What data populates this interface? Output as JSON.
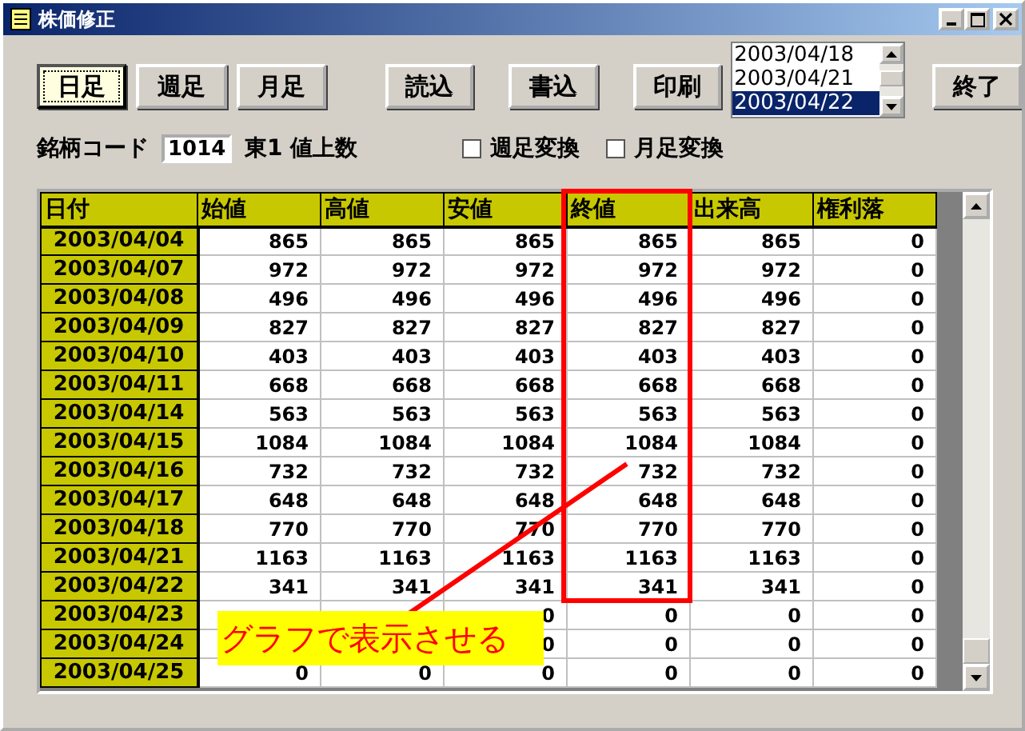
{
  "window": {
    "title": "株価修正"
  },
  "period_buttons": [
    {
      "label": "日足",
      "selected": true
    },
    {
      "label": "週足",
      "selected": false
    },
    {
      "label": "月足",
      "selected": false
    }
  ],
  "action_buttons": [
    "読込",
    "書込",
    "印刷"
  ],
  "date_list": [
    {
      "label": "2003/04/18",
      "selected": false
    },
    {
      "label": "2003/04/21",
      "selected": false
    },
    {
      "label": "2003/04/22",
      "selected": true
    }
  ],
  "exit_button": "終了",
  "code": {
    "label": "銘柄コード",
    "value": "1014",
    "name": "東1 値上数"
  },
  "options": [
    {
      "label": "週足変換",
      "checked": false
    },
    {
      "label": "月足変換",
      "checked": false
    }
  ],
  "table": {
    "columns": [
      {
        "label": "日付",
        "highlighted": false
      },
      {
        "label": "始値",
        "highlighted": false
      },
      {
        "label": "高値",
        "highlighted": false
      },
      {
        "label": "安値",
        "highlighted": false
      },
      {
        "label": "終値",
        "highlighted": true
      },
      {
        "label": "出来高",
        "highlighted": false
      },
      {
        "label": "権利落",
        "highlighted": false
      }
    ],
    "rows": [
      [
        "2003/04/04",
        "865",
        "865",
        "865",
        "865",
        "865",
        "0"
      ],
      [
        "2003/04/07",
        "972",
        "972",
        "972",
        "972",
        "972",
        "0"
      ],
      [
        "2003/04/08",
        "496",
        "496",
        "496",
        "496",
        "496",
        "0"
      ],
      [
        "2003/04/09",
        "827",
        "827",
        "827",
        "827",
        "827",
        "0"
      ],
      [
        "2003/04/10",
        "403",
        "403",
        "403",
        "403",
        "403",
        "0"
      ],
      [
        "2003/04/11",
        "668",
        "668",
        "668",
        "668",
        "668",
        "0"
      ],
      [
        "2003/04/14",
        "563",
        "563",
        "563",
        "563",
        "563",
        "0"
      ],
      [
        "2003/04/15",
        "1084",
        "1084",
        "1084",
        "1084",
        "1084",
        "0"
      ],
      [
        "2003/04/16",
        "732",
        "732",
        "732",
        "732",
        "732",
        "0"
      ],
      [
        "2003/04/17",
        "648",
        "648",
        "648",
        "648",
        "648",
        "0"
      ],
      [
        "2003/04/18",
        "770",
        "770",
        "770",
        "770",
        "770",
        "0"
      ],
      [
        "2003/04/21",
        "1163",
        "1163",
        "1163",
        "1163",
        "1163",
        "0"
      ],
      [
        "2003/04/22",
        "341",
        "341",
        "341",
        "341",
        "341",
        "0"
      ],
      [
        "2003/04/23",
        null,
        null,
        "0",
        "0",
        "0",
        "0"
      ],
      [
        "2003/04/24",
        null,
        null,
        "0",
        "0",
        "0",
        "0"
      ],
      [
        "2003/04/25",
        "0",
        "0",
        "0",
        "0",
        "0",
        "0"
      ]
    ]
  },
  "annotation": {
    "text": "グラフで表示させる"
  }
}
